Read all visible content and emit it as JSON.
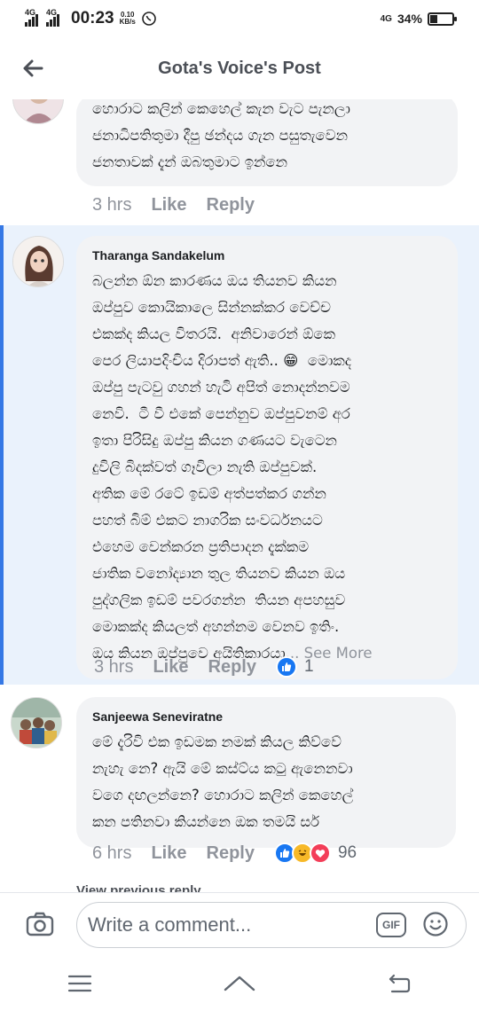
{
  "status_bar": {
    "network_1": "4G",
    "network_2": "4G",
    "time": "00:23",
    "speed_value": "0.10",
    "speed_unit": "KB/s",
    "network_right": "4G",
    "battery": "34%",
    "battery_level": 0.34
  },
  "header": {
    "title": "Gota's Voice's Post"
  },
  "comments": [
    {
      "author": "",
      "text": "හොරාට කලින් කෙහෙල් කැන වැට පැනලා\nජනාධිපතිතුමා දීපු ඡන්දය ගැන පසුතැවෙන\nජනතාවක් දැන් ඔබතුමාට ඉන්නෙ",
      "time": "3 hrs",
      "like": "Like",
      "reply": "Reply"
    },
    {
      "author": "Tharanga Sandakelum",
      "text": "බලන්න ඕන කාරණය ඔය තියනව කියන\nඔප්පුව කොයිකාලෙ සින්නක්කර වෙච්ච\nඑකක්ද කියල විතරයි.  අනිවාරෙන් ඕකෙ\nපෙර ලියාපදිංචිය දිරාපත් ඇති.. 😁  මොකද\nඔප්පු පැටවු ගහන් හැටි අපිත් නොදන්නවම\nනෙවි.  ටී වී එකේ පෙන්නුව ඔප්පුවනම් අර\nඉතා පිරිසිදු ඔප්පු කියන ගණයට වැටෙන\nදුවිලි බිදක්වත් ගෑවිලා නැති ඔප්පුවක්.\nඅතික මේ රටේ ඉඩම් අත්පත්කර ගන්න\nපහත් බිම් එකට නාගරික සංවර්ධනයට\nඑහෙම වෙන්කරන ප්‍රතිපාදන දැක්කම\nජාතික වනෝද්‍යාන තුල තියනව කියන ඔය\nපුද්ගලික ඉඩම් පවරගන්න  තියන අපහසුව\nමොකක්ද කියලත් අහන්නම වෙනව ඉතිං.\nඔය කියන ඔප්පුවෙ අයිතිකාරයා",
      "see_more": "... See More",
      "time": "3 hrs",
      "like": "Like",
      "reply": "Reply",
      "reaction_count": "1"
    },
    {
      "author": "Sanjeewa Seneviratne",
      "text": "මේ දැරිවි එක ඉඩමක නමක් කියල කිව්වේ\nනැහැ නෙ? ඇයි මේ කස්ට්ය කටු ඇනෙනවා\nවගෙ දඟලන්නෙ? හොරාට කලින් කෙහෙල්\nකන පතිනවා කියන්නෙ ඔක තමයි සර්",
      "time": "6 hrs",
      "like": "Like",
      "reply": "Reply",
      "reaction_count": "96"
    }
  ],
  "view_previous": "View previous reply",
  "composer": {
    "placeholder": "Write a comment...",
    "gif_label": "GIF"
  },
  "icons": {
    "back": "arrow-left-icon",
    "camera": "camera-icon",
    "emoji": "smiley-icon",
    "like_reaction": "thumbs-up-icon",
    "haha_reaction": "laughing-face-icon",
    "love_reaction": "heart-icon"
  },
  "colors": {
    "accent": "#3578e5",
    "highlight_bg": "#eaf2fc",
    "bubble_bg": "#f2f3f5",
    "meta_text": "#90949c"
  }
}
